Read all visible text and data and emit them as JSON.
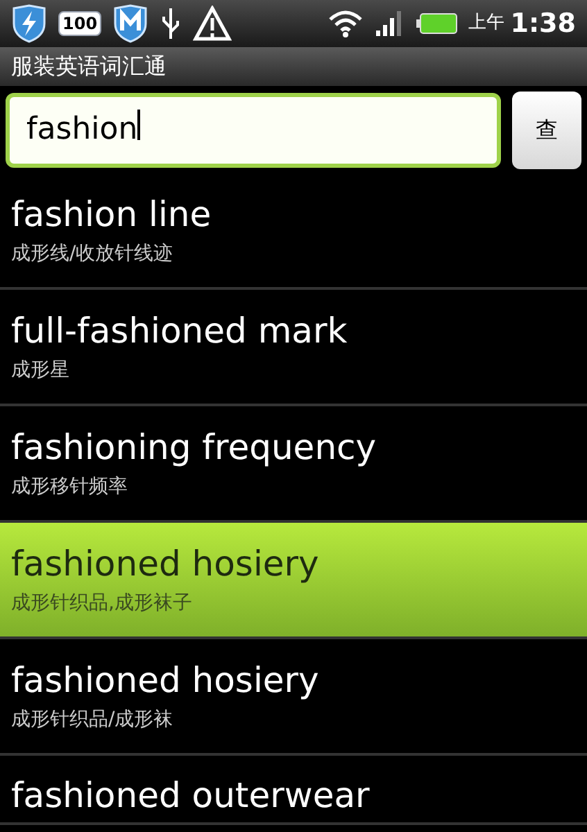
{
  "status_bar": {
    "battery_badge": "100",
    "am_pm": "上午",
    "time": "1:38"
  },
  "app_title": "服装英语词汇通",
  "search": {
    "value": "fashion",
    "button": "查"
  },
  "results": [
    {
      "term": "fashion line",
      "meaning": "成形线/收放针线迹",
      "selected": false
    },
    {
      "term": "full-fashioned mark",
      "meaning": "成形星",
      "selected": false
    },
    {
      "term": "fashioning frequency",
      "meaning": "成形移针频率",
      "selected": false
    },
    {
      "term": "fashioned hosiery",
      "meaning": "成形针织品,成形袜子",
      "selected": true
    },
    {
      "term": "fashioned hosiery",
      "meaning": "成形针织品/成形袜",
      "selected": false
    },
    {
      "term": "fashioned outerwear",
      "selected": false
    }
  ]
}
